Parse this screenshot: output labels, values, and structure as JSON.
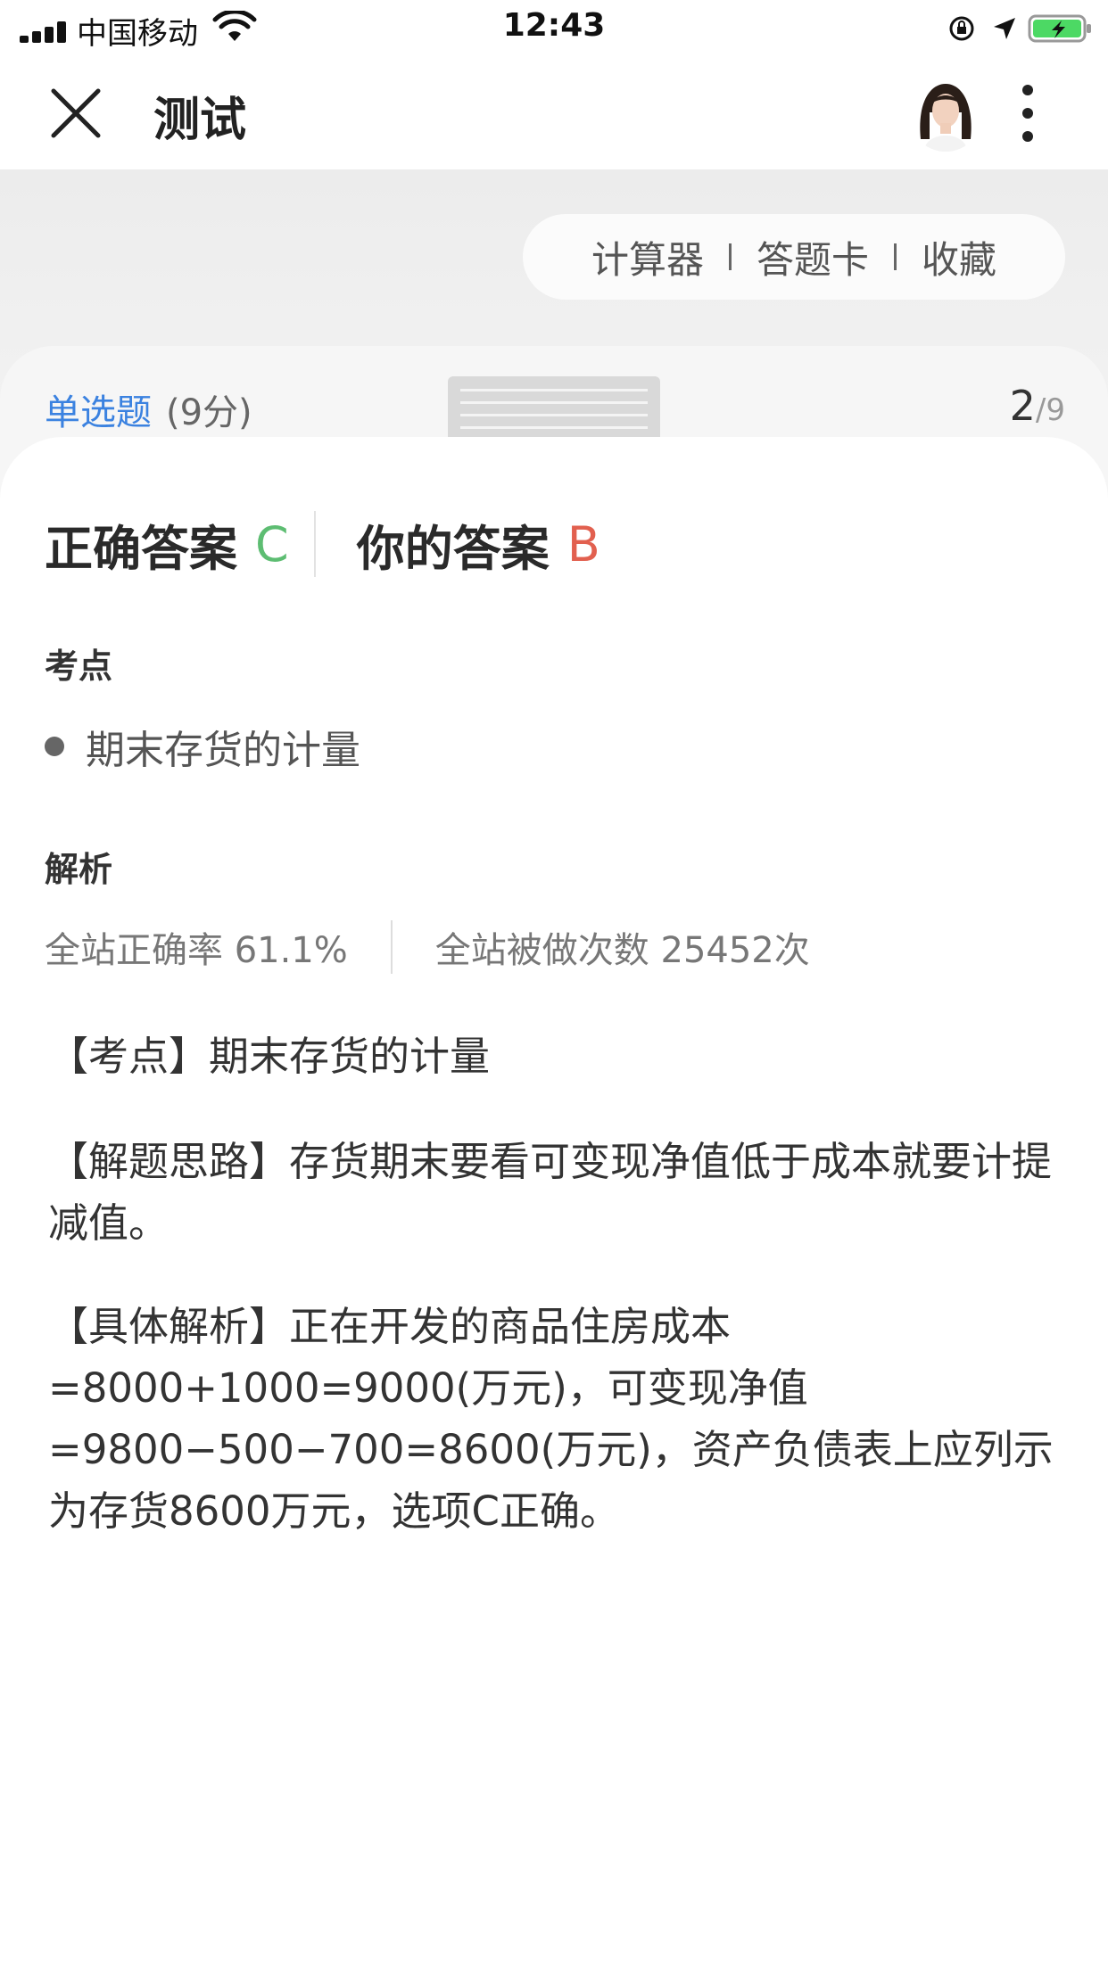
{
  "status_bar": {
    "carrier": "中国移动",
    "time": "12:43"
  },
  "nav": {
    "title": "测试",
    "close_icon": "close-icon",
    "more_icon": "more-vertical-icon"
  },
  "tools": {
    "calculator": "计算器",
    "answer_card": "答题卡",
    "favorite": "收藏"
  },
  "question": {
    "type": "单选题",
    "score": "(9分)",
    "current": "2",
    "total": "/9"
  },
  "answers": {
    "correct_label": "正确答案",
    "correct_value": "C",
    "yours_label": "你的答案",
    "yours_value": "B"
  },
  "exam_point": {
    "title": "考点",
    "item": "期末存货的计量"
  },
  "analysis": {
    "title": "解析",
    "accuracy": "全站正确率 61.1%",
    "attempts": "全站被做次数 25452次",
    "p1": "【考点】期末存货的计量",
    "p2": "【解题思路】存货期末要看可变现净值低于成本就要计提减值。",
    "p3": "【具体解析】正在开发的商品住房成本=8000+1000=9000(万元)，可变现净值=9800−500−700=8600(万元)，资产负债表上应列示为存货8600万元，选项C正确。"
  },
  "colors": {
    "accent_blue": "#3b82e0",
    "correct_green": "#5dbd72",
    "wrong_red": "#e2604f"
  }
}
